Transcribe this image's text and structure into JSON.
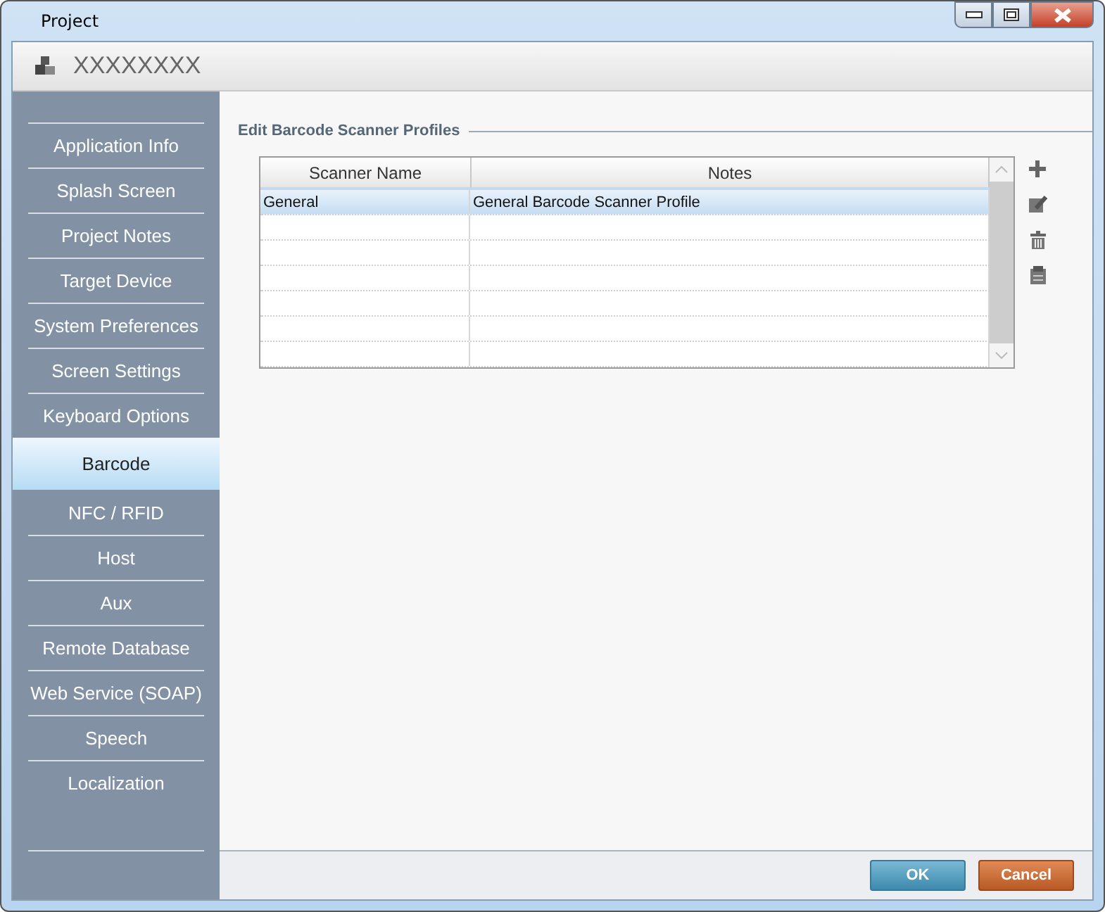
{
  "window": {
    "title": "Project"
  },
  "header": {
    "title": "XXXXXXXX"
  },
  "sidebar": {
    "items": [
      {
        "label": "Application Info",
        "selected": false
      },
      {
        "label": "Splash Screen",
        "selected": false
      },
      {
        "label": "Project Notes",
        "selected": false
      },
      {
        "label": "Target Device",
        "selected": false
      },
      {
        "label": "System Preferences",
        "selected": false
      },
      {
        "label": "Screen Settings",
        "selected": false
      },
      {
        "label": "Keyboard Options",
        "selected": false
      },
      {
        "label": "Barcode",
        "selected": true
      },
      {
        "label": "NFC / RFID",
        "selected": false
      },
      {
        "label": "Host",
        "selected": false
      },
      {
        "label": "Aux",
        "selected": false
      },
      {
        "label": "Remote Database",
        "selected": false
      },
      {
        "label": "Web Service (SOAP)",
        "selected": false
      },
      {
        "label": "Speech",
        "selected": false
      },
      {
        "label": "Localization",
        "selected": false
      }
    ]
  },
  "section": {
    "title": "Edit Barcode Scanner Profiles"
  },
  "table": {
    "columns": [
      "Scanner Name",
      "Notes"
    ],
    "rows": [
      {
        "cells": [
          "General",
          "General Barcode Scanner Profile"
        ],
        "selected": true
      }
    ]
  },
  "tools": [
    {
      "kind": "add"
    },
    {
      "kind": "edit"
    },
    {
      "kind": "delete"
    },
    {
      "kind": "copy"
    }
  ],
  "buttons": [
    {
      "label": "OK",
      "kind": "primary"
    },
    {
      "label": "Cancel",
      "kind": "cancel"
    }
  ]
}
